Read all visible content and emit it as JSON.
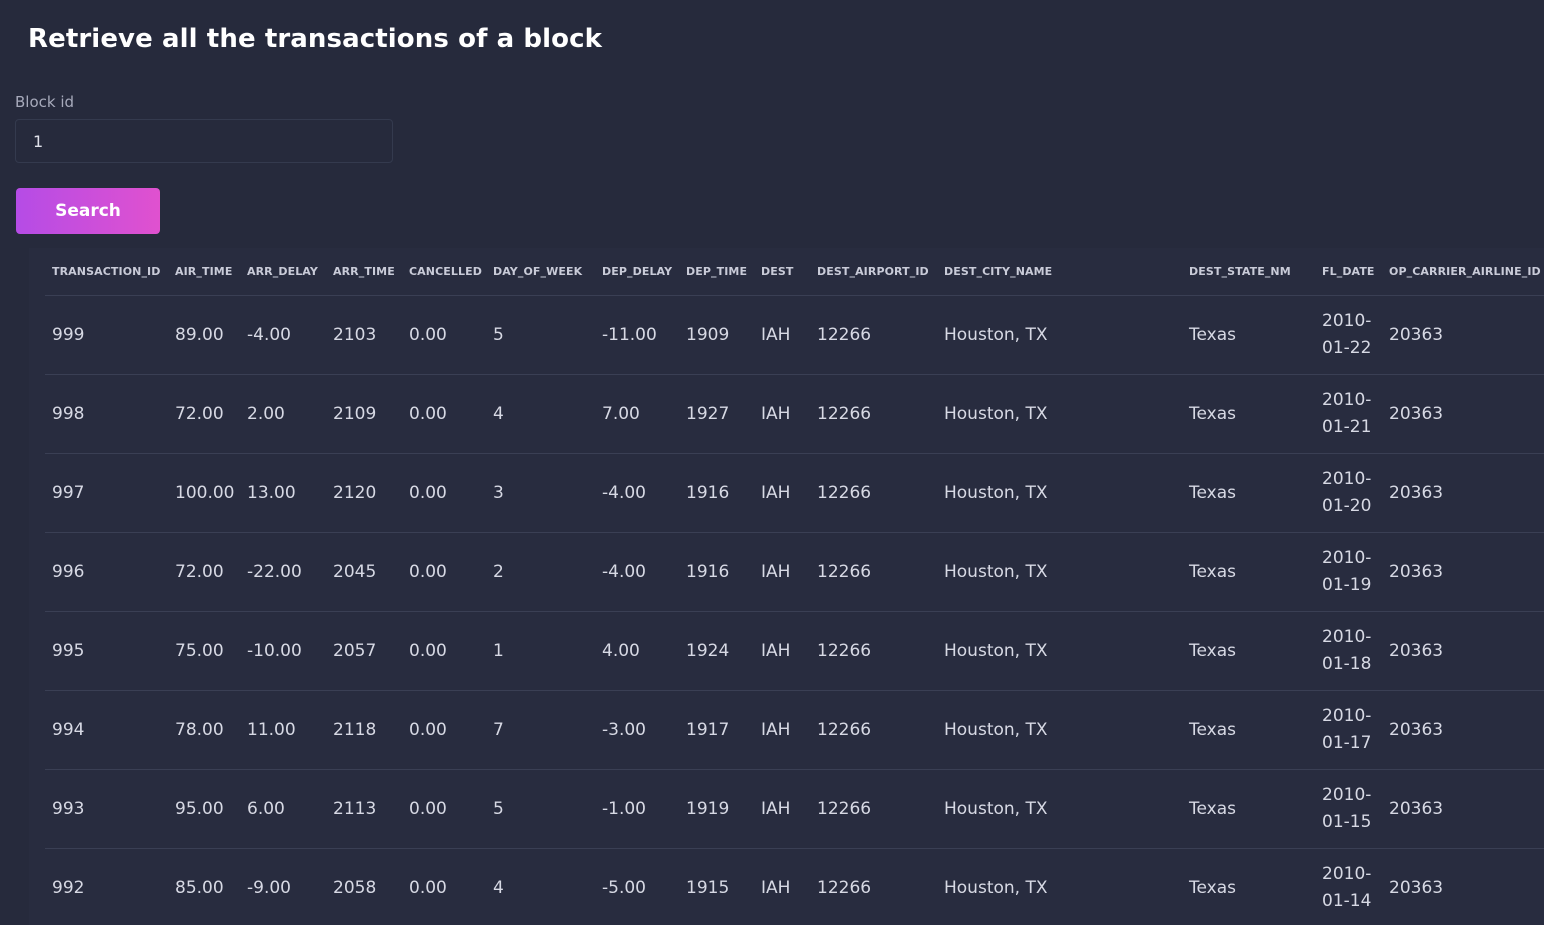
{
  "page": {
    "title": "Retrieve all the transactions of a block"
  },
  "form": {
    "block_id_label": "Block id",
    "block_id_value": "1",
    "search_label": "Search"
  },
  "table": {
    "columns": [
      "TRANSACTION_ID",
      "AIR_TIME",
      "ARR_DELAY",
      "ARR_TIME",
      "CANCELLED",
      "DAY_OF_WEEK",
      "DEP_DELAY",
      "DEP_TIME",
      "DEST",
      "DEST_AIRPORT_ID",
      "DEST_CITY_NAME",
      "DEST_STATE_NM",
      "FL_DATE",
      "OP_CARRIER_AIRLINE_ID"
    ],
    "rows": [
      [
        "999",
        "89.00",
        "-4.00",
        "2103",
        "0.00",
        "5",
        "-11.00",
        "1909",
        "IAH",
        "12266",
        "Houston, TX",
        "Texas",
        "2010-01-22",
        "20363"
      ],
      [
        "998",
        "72.00",
        "2.00",
        "2109",
        "0.00",
        "4",
        "7.00",
        "1927",
        "IAH",
        "12266",
        "Houston, TX",
        "Texas",
        "2010-01-21",
        "20363"
      ],
      [
        "997",
        "100.00",
        "13.00",
        "2120",
        "0.00",
        "3",
        "-4.00",
        "1916",
        "IAH",
        "12266",
        "Houston, TX",
        "Texas",
        "2010-01-20",
        "20363"
      ],
      [
        "996",
        "72.00",
        "-22.00",
        "2045",
        "0.00",
        "2",
        "-4.00",
        "1916",
        "IAH",
        "12266",
        "Houston, TX",
        "Texas",
        "2010-01-19",
        "20363"
      ],
      [
        "995",
        "75.00",
        "-10.00",
        "2057",
        "0.00",
        "1",
        "4.00",
        "1924",
        "IAH",
        "12266",
        "Houston, TX",
        "Texas",
        "2010-01-18",
        "20363"
      ],
      [
        "994",
        "78.00",
        "11.00",
        "2118",
        "0.00",
        "7",
        "-3.00",
        "1917",
        "IAH",
        "12266",
        "Houston, TX",
        "Texas",
        "2010-01-17",
        "20363"
      ],
      [
        "993",
        "95.00",
        "6.00",
        "2113",
        "0.00",
        "5",
        "-1.00",
        "1919",
        "IAH",
        "12266",
        "Houston, TX",
        "Texas",
        "2010-01-15",
        "20363"
      ],
      [
        "992",
        "85.00",
        "-9.00",
        "2058",
        "0.00",
        "4",
        "-5.00",
        "1915",
        "IAH",
        "12266",
        "Houston, TX",
        "Texas",
        "2010-01-14",
        "20363"
      ]
    ]
  },
  "colors": {
    "background": "#262a3c",
    "accent_start": "#b54ce6",
    "accent_end": "#e051cf",
    "text": "#d7d9e4",
    "divider": "#3a3f54"
  }
}
